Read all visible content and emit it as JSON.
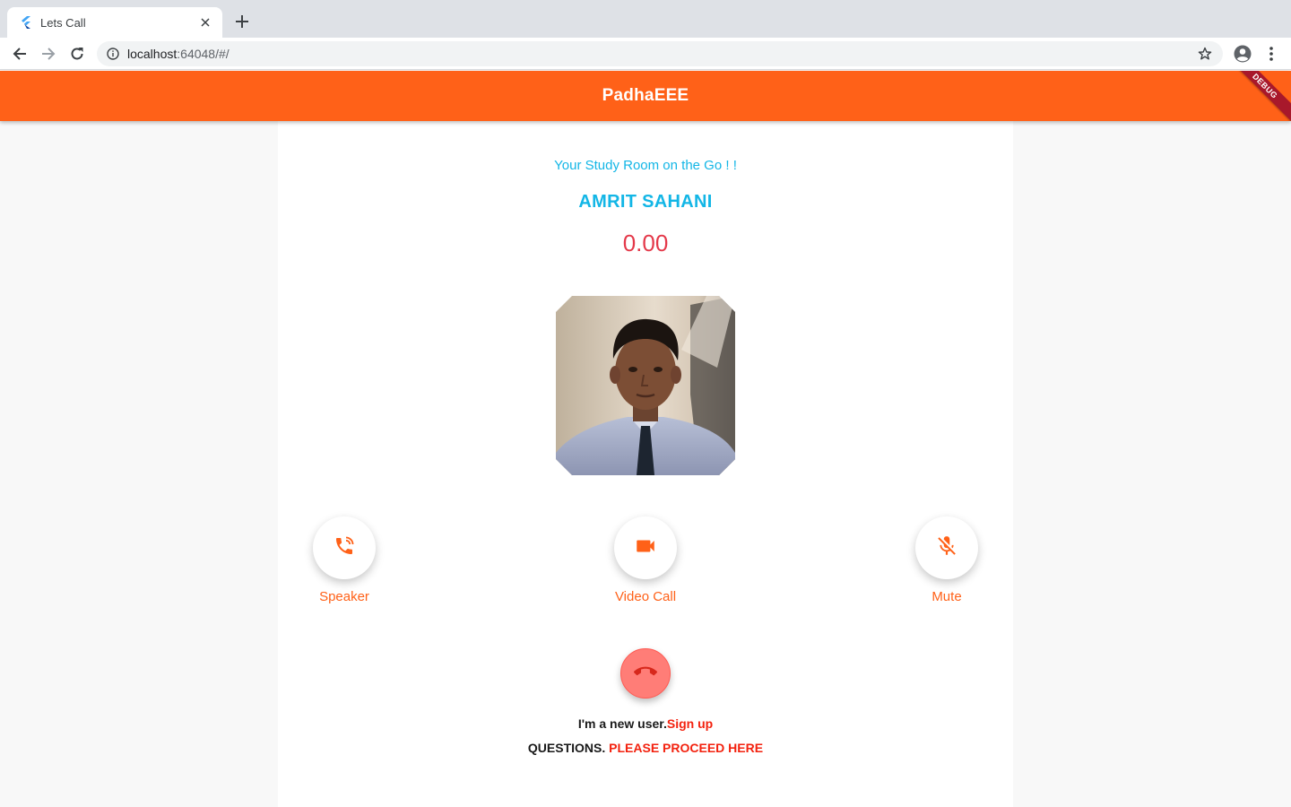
{
  "browser": {
    "tab_title": "Lets Call",
    "url_host": "localhost",
    "url_path": ":64048/#/"
  },
  "appbar": {
    "title": "PadhaEEE",
    "debug_label": "DEBUG",
    "color": "#ff6118"
  },
  "call": {
    "tagline": "Your Study Room on the Go ! !",
    "caller_name": "AMRIT SAHANI",
    "timer": "0.00"
  },
  "actions": [
    {
      "label": "Speaker",
      "icon": "speaker-phone-icon"
    },
    {
      "label": "Video Call",
      "icon": "videocam-icon"
    },
    {
      "label": "Mute",
      "icon": "mic-off-icon"
    }
  ],
  "hangup": {
    "icon": "call-end-icon",
    "color": "#ff7d77"
  },
  "footer": {
    "signup_prompt": "I'm a new user.",
    "signup_link": "Sign up",
    "questions_prompt": "QUESTIONS.",
    "questions_link": "PLEASE PROCEED HERE"
  },
  "colors": {
    "accent_blue": "#13b6e6",
    "timer_red": "#e4394a",
    "link_red": "#f3220f"
  }
}
